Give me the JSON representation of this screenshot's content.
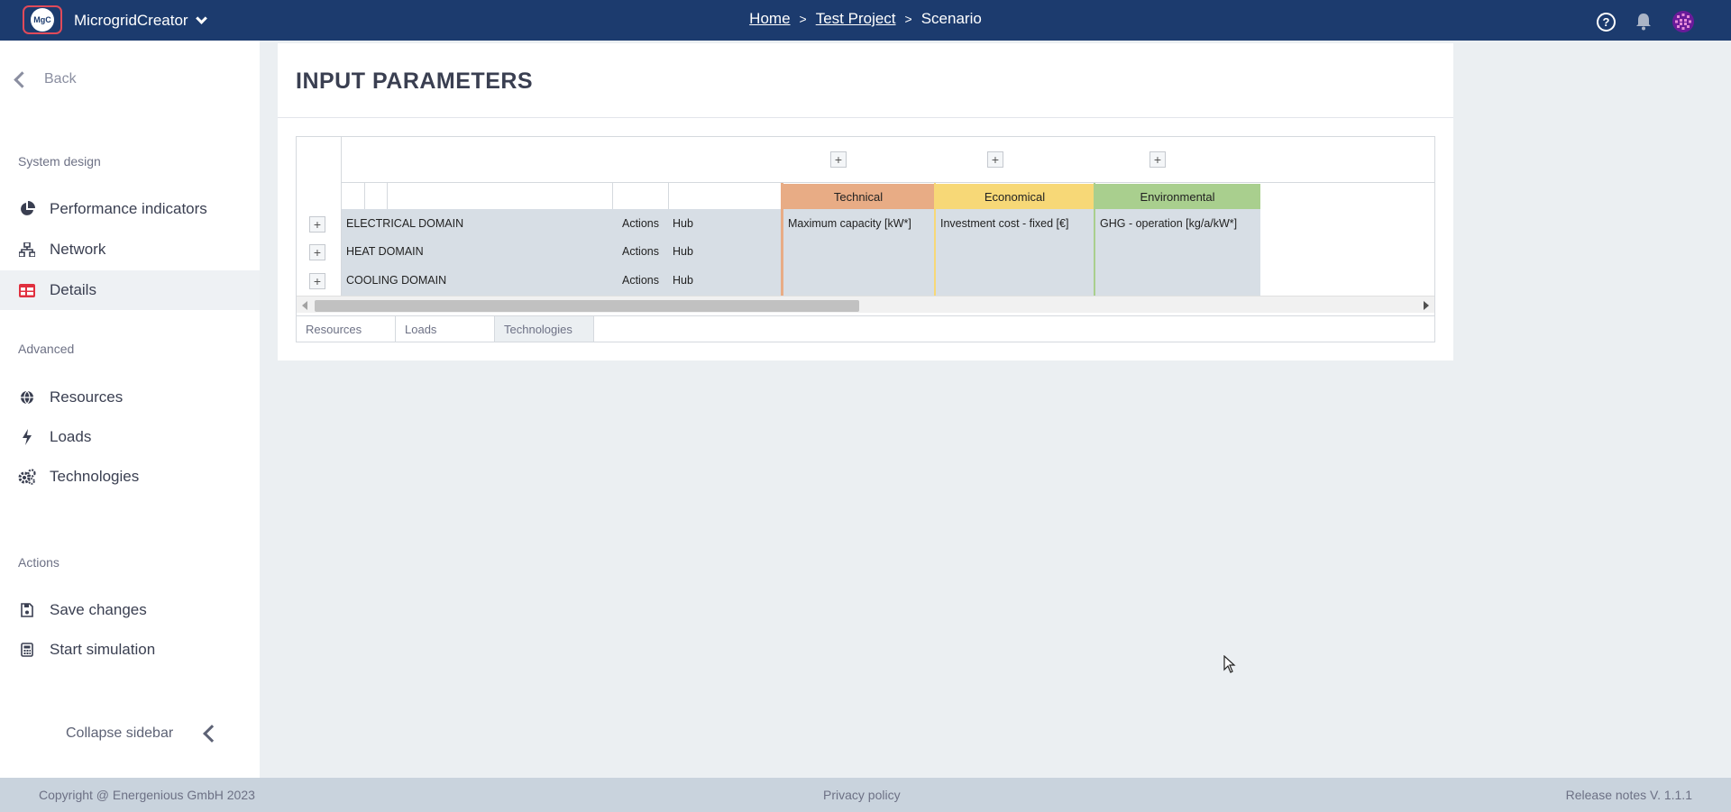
{
  "app": {
    "name": "MicrogridCreator",
    "logo_text": "MgC"
  },
  "breadcrumb": {
    "home": "Home",
    "project": "Test Project",
    "current": "Scenario",
    "separator": ">"
  },
  "sidebar": {
    "back": "Back",
    "system_design_title": "System design",
    "system_design": [
      {
        "label": "Performance indicators",
        "icon": "pie-chart-icon"
      },
      {
        "label": "Network",
        "icon": "network-icon"
      },
      {
        "label": "Details",
        "icon": "table-icon",
        "active": true
      }
    ],
    "advanced_title": "Advanced",
    "advanced": [
      {
        "label": "Resources",
        "icon": "globe-icon"
      },
      {
        "label": "Loads",
        "icon": "bolt-icon"
      },
      {
        "label": "Technologies",
        "icon": "gears-icon"
      }
    ],
    "actions_title": "Actions",
    "actions": [
      {
        "label": "Save changes",
        "icon": "save-icon"
      },
      {
        "label": "Start simulation",
        "icon": "calculator-icon"
      }
    ],
    "collapse": "Collapse sidebar"
  },
  "main": {
    "title": "INPUT PARAMETERS",
    "groups": [
      {
        "label": "Technical",
        "color": "#e8ac85",
        "body": "#d5dde4"
      },
      {
        "label": "Economical",
        "color": "#f7d877",
        "body": "#d5dde4"
      },
      {
        "label": "Environmental",
        "color": "#a9cf8e",
        "body": "#d5dde4"
      }
    ],
    "rows": [
      {
        "name": "ELECTRICAL DOMAIN",
        "actions": "Actions",
        "hub": "Hub",
        "technical": "Maximum capacity [kW*]",
        "economical": "Investment cost - fixed [€]",
        "environmental": "GHG - operation [kg/a/kW*]"
      },
      {
        "name": "HEAT DOMAIN",
        "actions": "Actions",
        "hub": "Hub",
        "technical": "",
        "economical": "",
        "environmental": ""
      },
      {
        "name": "COOLING DOMAIN",
        "actions": "Actions",
        "hub": "Hub",
        "technical": "",
        "economical": "",
        "environmental": ""
      }
    ],
    "plus": "+",
    "tabs": [
      {
        "label": "Resources"
      },
      {
        "label": "Loads"
      },
      {
        "label": "Technologies",
        "active": true
      }
    ]
  },
  "footer": {
    "copyright": "Copyright @ Energenious GmbH 2023",
    "privacy": "Privacy policy",
    "release": "Release notes V. 1.1.1"
  }
}
